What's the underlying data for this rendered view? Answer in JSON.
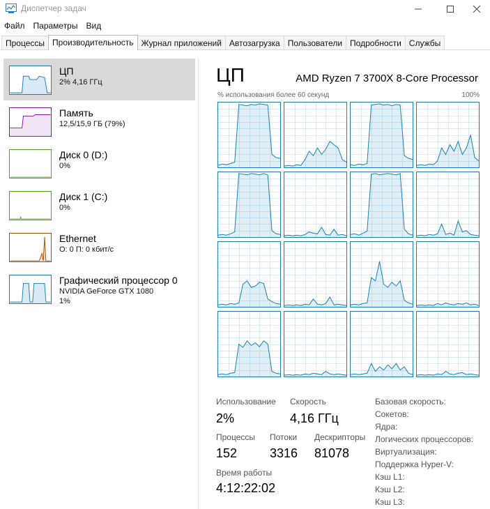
{
  "window": {
    "title": "Диспетчер задач"
  },
  "menu": [
    "Файл",
    "Параметры",
    "Вид"
  ],
  "tabs": [
    {
      "label": "Процессы",
      "active": false
    },
    {
      "label": "Производительность",
      "active": true
    },
    {
      "label": "Журнал приложений",
      "active": false
    },
    {
      "label": "Автозагрузка",
      "active": false
    },
    {
      "label": "Пользователи",
      "active": false
    },
    {
      "label": "Подробности",
      "active": false
    },
    {
      "label": "Службы",
      "active": false
    }
  ],
  "resources": [
    {
      "name": "ЦП",
      "sub1": "2% 4,16 ГГц",
      "sub2": "",
      "color": "#1a80b3",
      "selected": true
    },
    {
      "name": "Память",
      "sub1": "12,5/15,9 ГБ (79%)",
      "sub2": "",
      "color": "#8b12ae",
      "selected": false
    },
    {
      "name": "Диск 0 (D:)",
      "sub1": "0%",
      "sub2": "",
      "color": "#4da60c",
      "selected": false
    },
    {
      "name": "Диск 1 (C:)",
      "sub1": "0%",
      "sub2": "",
      "color": "#4da60c",
      "selected": false
    },
    {
      "name": "Ethernet",
      "sub1": "О: 0 П: 0 кбит/с",
      "sub2": "",
      "color": "#a74f01",
      "selected": false
    },
    {
      "name": "Графический процессор 0",
      "sub1": "NVIDIA GeForce GTX 1080",
      "sub2": "1%",
      "color": "#1a80b3",
      "selected": false
    }
  ],
  "cpu": {
    "title": "ЦП",
    "model": "AMD Ryzen 7 3700X 8-Core Processor",
    "util_label": "% использования более 60 секунд",
    "util_max": "100%",
    "stats": {
      "usage_label": "Использование",
      "usage_value": "2%",
      "speed_label": "Скорость",
      "speed_value": "4,16 ГГц",
      "processes_label": "Процессы",
      "processes_value": "152",
      "threads_label": "Потоки",
      "threads_value": "3316",
      "handles_label": "Дескрипторы",
      "handles_value": "81078",
      "uptime_label": "Время работы",
      "uptime_value": "4:12:22:02"
    },
    "details": [
      "Базовая скорость:",
      "Сокетов:",
      "Ядра:",
      "Логических процессоров:",
      "Виртуализация:",
      "Поддержка Hyper-V:",
      "Кэш L1:",
      "Кэш L2:",
      "Кэш L3:"
    ]
  },
  "chart_data": {
    "type": "line",
    "xlim": [
      0,
      60
    ],
    "ylim": [
      0,
      100
    ],
    "grid": true,
    "x": [
      0,
      4,
      8,
      12,
      16,
      20,
      24,
      28,
      32,
      36,
      40,
      44,
      48,
      52,
      56,
      60
    ],
    "series": [
      {
        "values": [
          3,
          5,
          4,
          6,
          8,
          97,
          96,
          95,
          97,
          96,
          98,
          97,
          96,
          20,
          15,
          14
        ]
      },
      {
        "values": [
          2,
          3,
          2,
          4,
          3,
          12,
          25,
          18,
          30,
          20,
          28,
          40,
          35,
          30,
          12,
          8
        ]
      },
      {
        "values": [
          4,
          3,
          5,
          4,
          6,
          96,
          97,
          98,
          96,
          97,
          95,
          97,
          96,
          18,
          14,
          12
        ]
      },
      {
        "values": [
          3,
          4,
          3,
          5,
          4,
          10,
          30,
          20,
          35,
          25,
          40,
          20,
          30,
          50,
          15,
          10
        ]
      },
      {
        "values": [
          3,
          4,
          3,
          5,
          8,
          98,
          97,
          96,
          98,
          97,
          96,
          98,
          96,
          10,
          5,
          4
        ]
      },
      {
        "values": [
          2,
          3,
          2,
          3,
          2,
          4,
          8,
          6,
          5,
          15,
          4,
          3,
          12,
          3,
          4,
          2
        ]
      },
      {
        "values": [
          4,
          5,
          3,
          6,
          9,
          97,
          98,
          96,
          97,
          98,
          97,
          96,
          98,
          12,
          5,
          3
        ]
      },
      {
        "values": [
          2,
          3,
          2,
          4,
          3,
          5,
          20,
          4,
          6,
          3,
          25,
          8,
          10,
          4,
          3,
          2
        ]
      },
      {
        "values": [
          3,
          4,
          3,
          5,
          4,
          6,
          35,
          40,
          30,
          32,
          38,
          36,
          12,
          8,
          5,
          4
        ]
      },
      {
        "values": [
          2,
          3,
          2,
          3,
          2,
          4,
          3,
          12,
          4,
          3,
          5,
          15,
          3,
          4,
          3,
          2
        ]
      },
      {
        "values": [
          3,
          4,
          3,
          5,
          6,
          45,
          40,
          70,
          35,
          30,
          38,
          32,
          40,
          10,
          6,
          4
        ]
      },
      {
        "values": [
          2,
          3,
          2,
          3,
          2,
          5,
          3,
          6,
          4,
          3,
          5,
          4,
          6,
          3,
          4,
          2
        ]
      },
      {
        "values": [
          3,
          4,
          3,
          5,
          6,
          50,
          45,
          55,
          48,
          52,
          46,
          55,
          50,
          8,
          5,
          4
        ]
      },
      {
        "values": [
          2,
          3,
          2,
          3,
          2,
          4,
          3,
          5,
          4,
          3,
          8,
          4,
          3,
          4,
          3,
          2
        ]
      },
      {
        "values": [
          3,
          4,
          3,
          4,
          5,
          20,
          8,
          15,
          10,
          18,
          12,
          20,
          10,
          15,
          5,
          3
        ]
      },
      {
        "values": [
          2,
          3,
          2,
          3,
          2,
          4,
          3,
          8,
          4,
          3,
          5,
          6,
          3,
          4,
          3,
          2
        ]
      }
    ]
  }
}
